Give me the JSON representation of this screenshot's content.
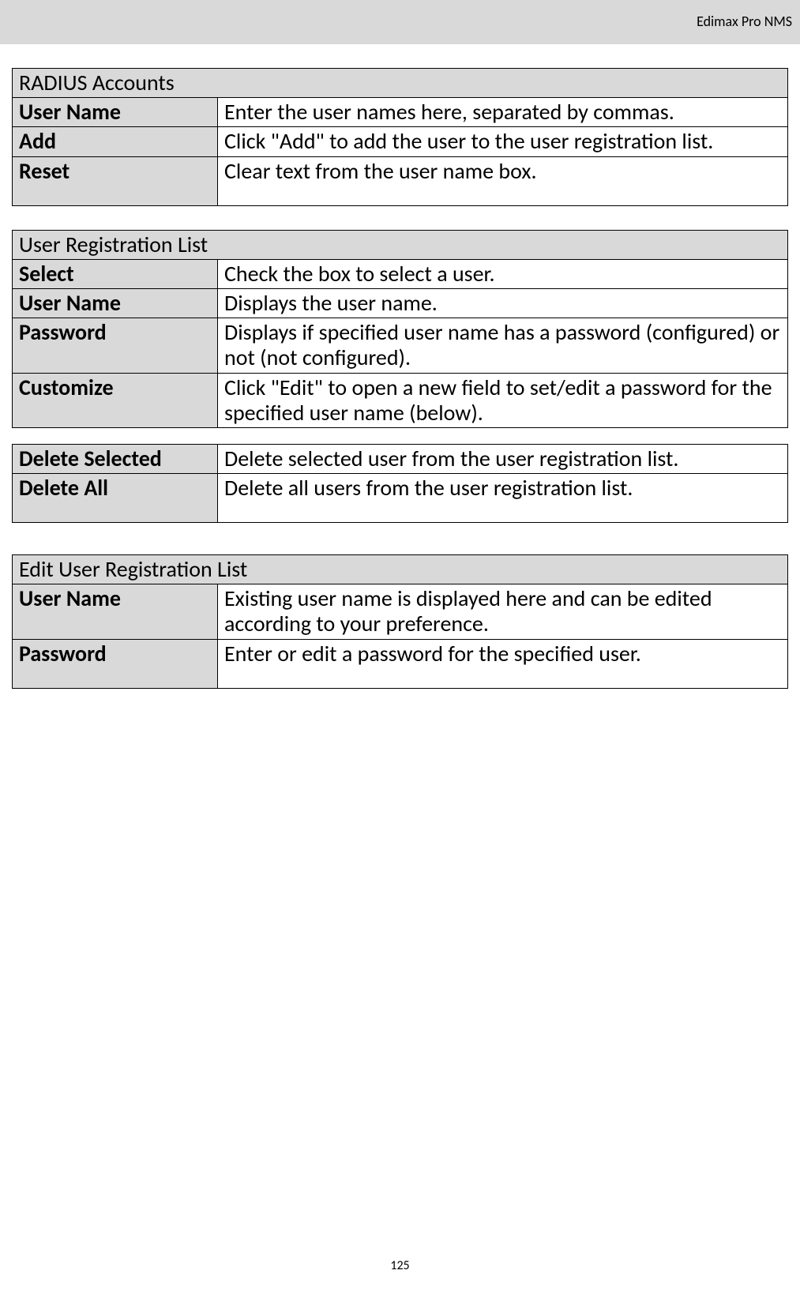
{
  "header": {
    "title": "Edimax Pro NMS"
  },
  "tables": {
    "radius_accounts": {
      "title": "RADIUS Accounts",
      "rows": [
        {
          "label": "User Name",
          "desc": "Enter the user names here, separated by commas."
        },
        {
          "label": "Add",
          "desc": "Click \"Add\" to add the user to the user registration list."
        },
        {
          "label": "Reset",
          "desc": "Clear text from the user name box."
        }
      ]
    },
    "user_registration_list": {
      "title": "User Registration List",
      "rows": [
        {
          "label": "Select",
          "desc": "Check the box to select a user."
        },
        {
          "label": "User Name",
          "desc": "Displays the user name."
        },
        {
          "label": "Password",
          "desc": "Displays if specified user name has a password (configured) or not (not configured)."
        },
        {
          "label": "Customize",
          "desc": "Click \"Edit\" to open a new field to set/edit a password for the specified user name (below)."
        }
      ]
    },
    "delete_actions": {
      "rows": [
        {
          "label": "Delete Selected",
          "desc": "Delete selected user from the user registration list."
        },
        {
          "label": "Delete All",
          "desc": "Delete all users from the user registration list."
        }
      ]
    },
    "edit_user_registration_list": {
      "title": "Edit User Registration List",
      "rows": [
        {
          "label": "User Name",
          "desc": "Existing user name is displayed here and can be edited according to your preference."
        },
        {
          "label": "Password",
          "desc": "Enter or edit a password for the specified user."
        }
      ]
    }
  },
  "page_number": "125"
}
